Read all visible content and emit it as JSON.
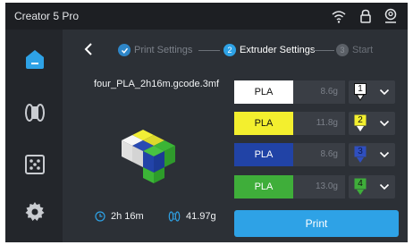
{
  "header": {
    "title": "Creator 5 Pro",
    "icons": [
      "wifi-icon",
      "lock-icon",
      "user-icon"
    ]
  },
  "sidebar": {
    "items": [
      "home",
      "filament",
      "calibration",
      "settings"
    ]
  },
  "steps": [
    {
      "number": "",
      "label": "Print Settings",
      "state": "done"
    },
    {
      "number": "2",
      "label": "Extruder Settings",
      "state": "active"
    },
    {
      "number": "3",
      "label": "Start",
      "state": "pending"
    }
  ],
  "file": {
    "name": "four_PLA_2h16m.gcode.3mf"
  },
  "stats": {
    "time": "2h 16m",
    "weight": "41.97g"
  },
  "slots": [
    {
      "material": "PLA",
      "weight": "8.6g",
      "color": "#ffffff",
      "text_color": "#111111",
      "extruder": "1",
      "badge_color": "#ffffff"
    },
    {
      "material": "PLA",
      "weight": "11.8g",
      "color": "#f3ef2e",
      "text_color": "#111111",
      "extruder": "2",
      "badge_color": "#f3ef2e"
    },
    {
      "material": "PLA",
      "weight": "8.6g",
      "color": "#2143a6",
      "text_color": "#ffffff",
      "extruder": "3",
      "badge_color": "#2f4fbf"
    },
    {
      "material": "PLA",
      "weight": "13.0g",
      "color": "#3fae3a",
      "text_color": "#ffffff",
      "extruder": "4",
      "badge_color": "#3fae3a"
    }
  ],
  "actions": {
    "print_label": "Print"
  },
  "colors": {
    "accent": "#2ea2e6",
    "background": "#2c3036",
    "sidebar": "#23262b"
  }
}
